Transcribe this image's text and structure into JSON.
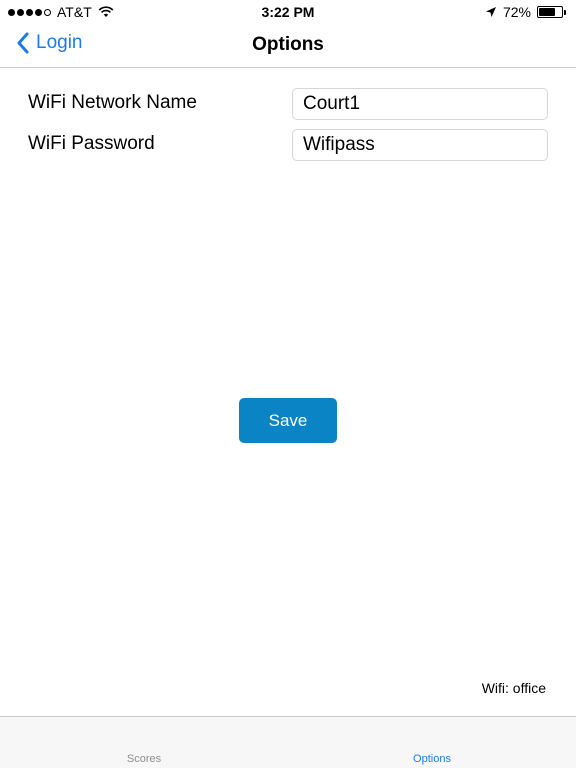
{
  "status_bar": {
    "carrier": "AT&T",
    "time": "3:22 PM",
    "battery_percent": "72%",
    "battery_level": 0.72,
    "signal_bars_filled": 4,
    "signal_bars_total": 5
  },
  "nav": {
    "back_label": "Login",
    "title": "Options",
    "accent_color": "#1a7cf0"
  },
  "form": {
    "network_name_label": "WiFi Network Name",
    "network_name_value": "Court1",
    "password_label": "WiFi Password",
    "password_value": "Wifipass"
  },
  "save_label": "Save",
  "save_color": "#0b84c6",
  "wifi_status": "Wifi: office",
  "tabs": [
    {
      "label": "Scores",
      "active": false
    },
    {
      "label": "Options",
      "active": true
    }
  ],
  "icons": [
    "signal-icon",
    "wifi-icon",
    "location-arrow-icon",
    "battery-icon",
    "chevron-left-icon"
  ]
}
